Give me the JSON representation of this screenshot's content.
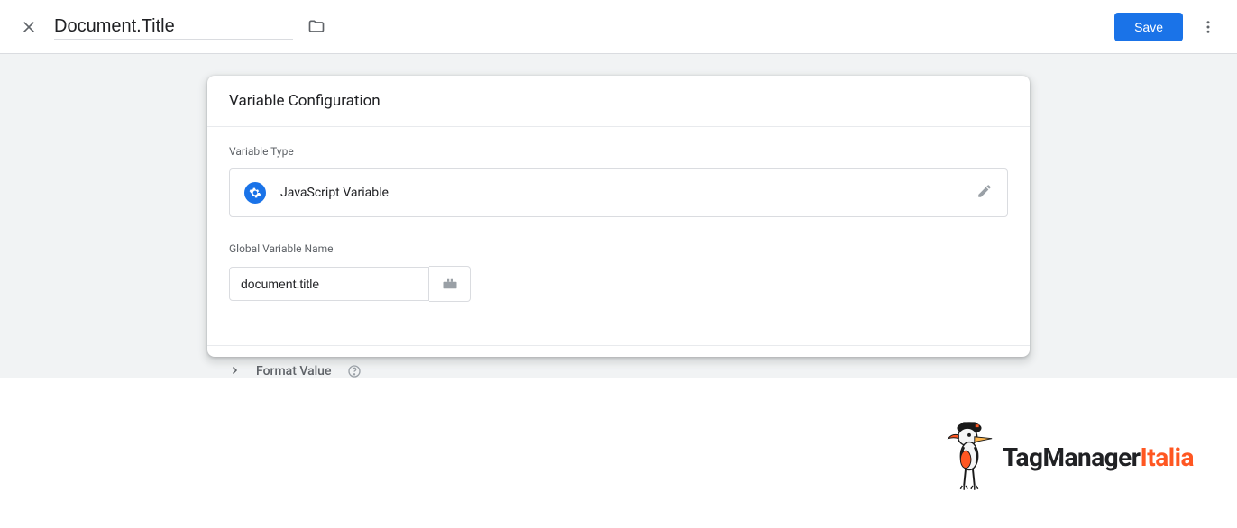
{
  "header": {
    "title": "Document.Title",
    "save_label": "Save"
  },
  "card": {
    "title": "Variable Configuration",
    "type_label": "Variable Type",
    "type_name": "JavaScript Variable",
    "global_var_label": "Global Variable Name",
    "global_var_value": "document.title",
    "format_label": "Format Value"
  },
  "brand": {
    "text1": "TagManager",
    "text2": "Italia"
  }
}
